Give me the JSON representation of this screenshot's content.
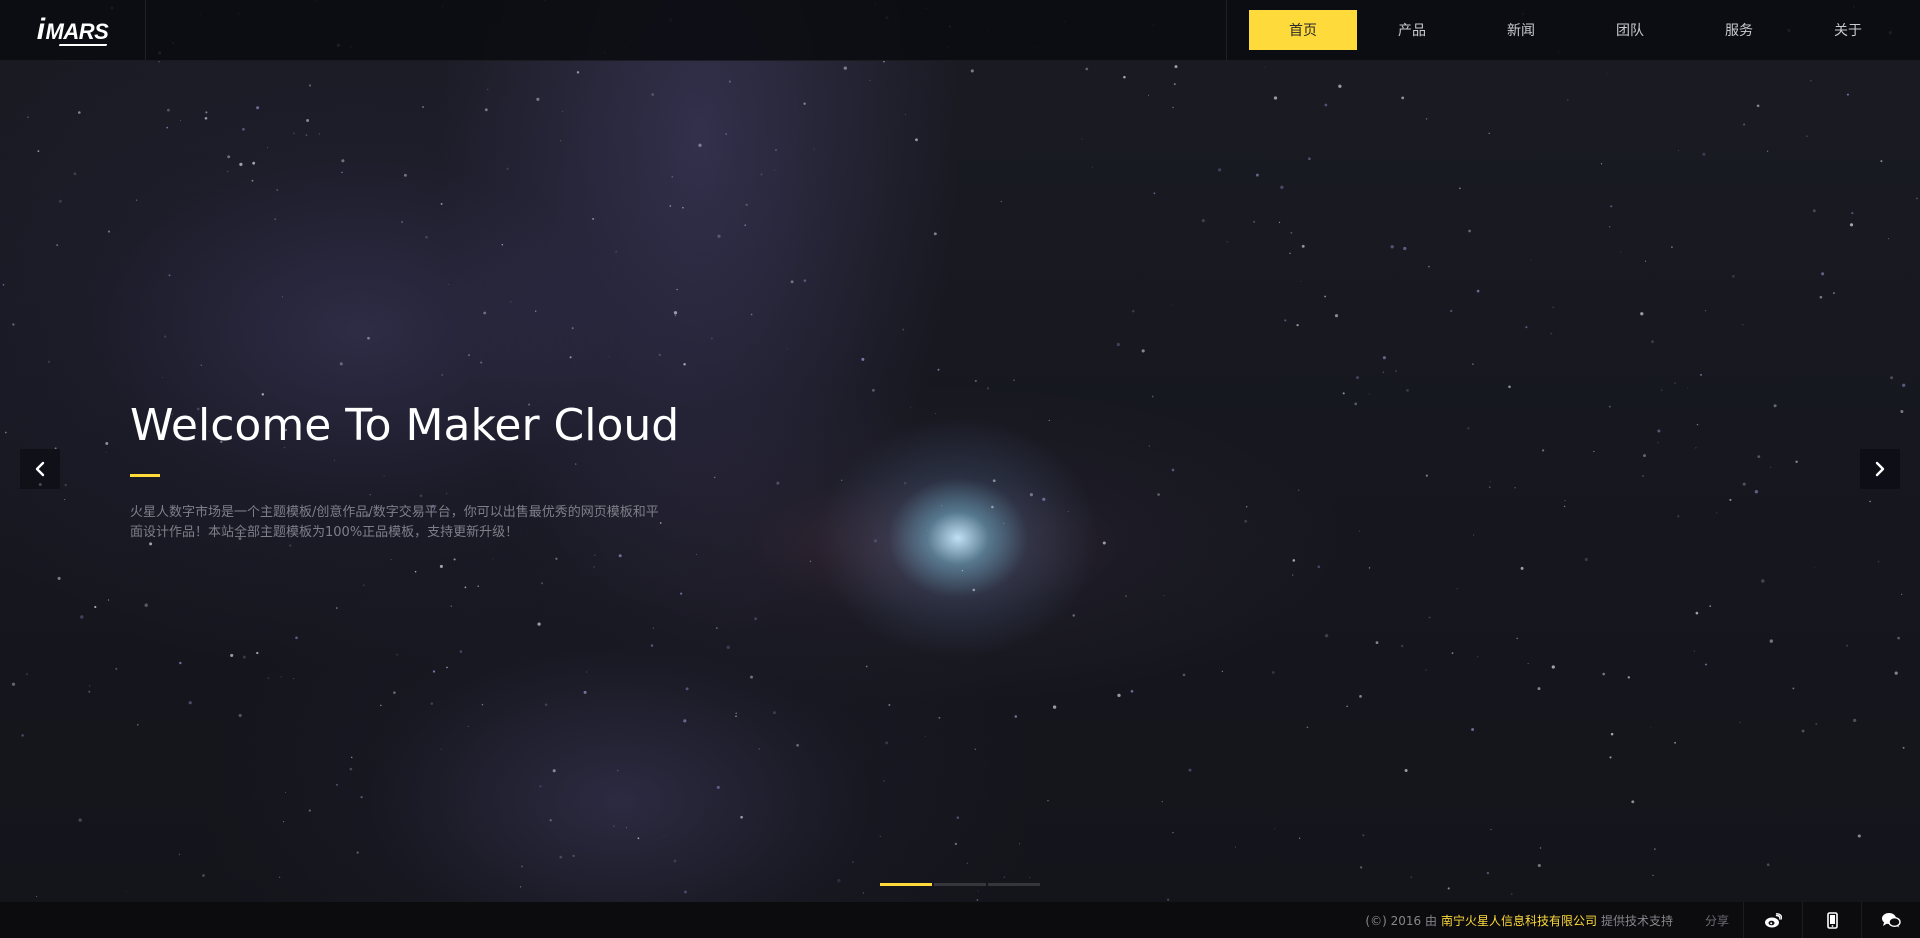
{
  "header": {
    "logo": {
      "i": "i",
      "text": "MARS"
    },
    "nav": [
      {
        "label": "首页",
        "active": true
      },
      {
        "label": "产品",
        "active": false
      },
      {
        "label": "新闻",
        "active": false
      },
      {
        "label": "团队",
        "active": false
      },
      {
        "label": "服务",
        "active": false
      },
      {
        "label": "关于",
        "active": false
      }
    ]
  },
  "hero": {
    "title": "Welcome To Maker Cloud",
    "description": "火星人数字市场是一个主题模板/创意作品/数字交易平台，你可以出售最优秀的网页模板和平面设计作品！本站全部主题模板为100%正品模板，支持更新升级！",
    "prev_icon": "chevron-left-icon",
    "next_icon": "chevron-right-icon",
    "slides_total": 3,
    "slide_active": 1
  },
  "footer": {
    "copyright_prefix": "(©) 2016 由",
    "company": "南宁火星人信息科技有限公司",
    "copyright_suffix": "提供技术支持",
    "share_label": "分享",
    "icons": [
      "weibo-icon",
      "mobile-icon",
      "wechat-icon"
    ]
  },
  "colors": {
    "accent": "#fedb3b",
    "header_bg": "#0a0b10",
    "footer_bg": "#0c0c0f",
    "text_muted": "#7d7f88"
  }
}
